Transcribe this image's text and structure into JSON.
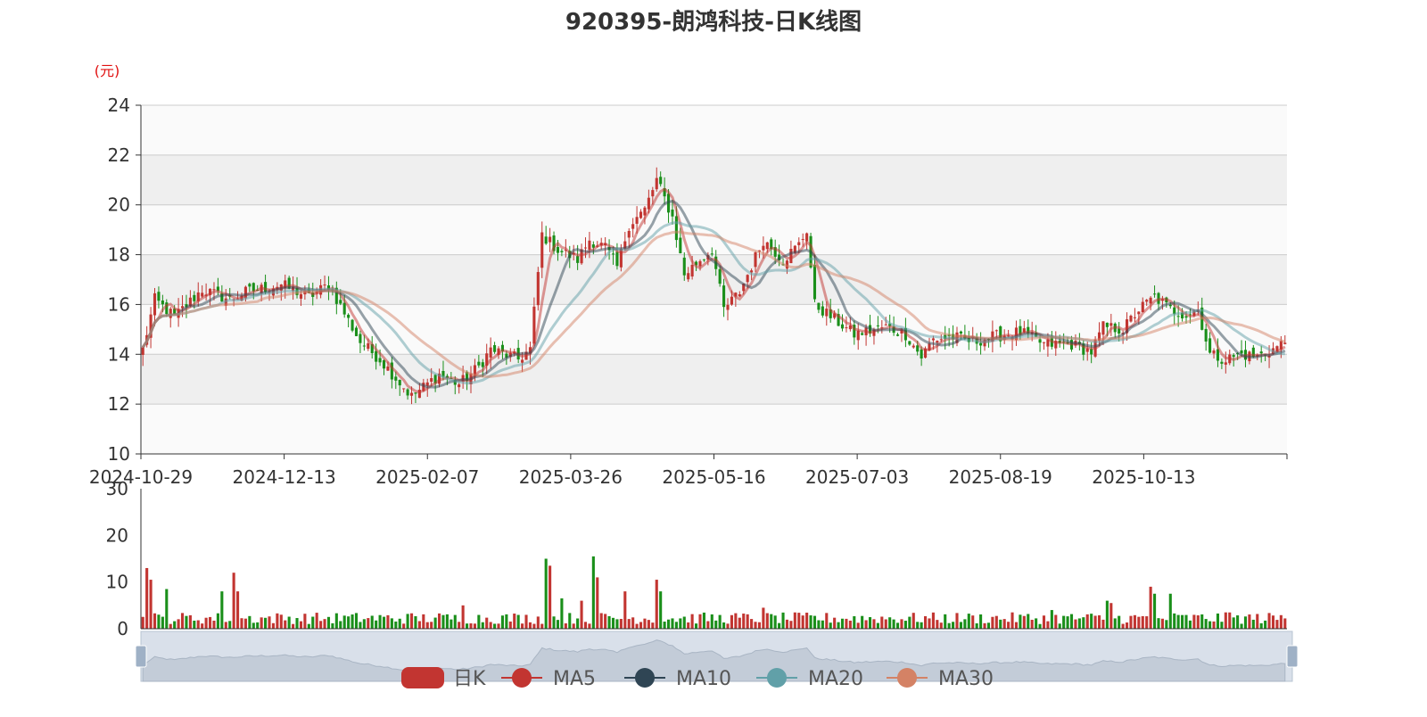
{
  "colors": {
    "up": "#c23531",
    "down": "#1a8f1a",
    "ma5": "#c23531",
    "ma10": "#2f4554",
    "ma20": "#61a0a8",
    "ma30": "#d48265",
    "grid_band": "#efefef",
    "axis": "#333333",
    "unit_label": "#e01010",
    "slider_bg": "#d9e0ea",
    "slider_handle": "#9fb1c6"
  },
  "chart_data": {
    "type": "candlestick",
    "title": "920395-朗鸿科技-日K线图",
    "y_unit_label": "(元)",
    "ylim": [
      10,
      24
    ],
    "y_ticks": [
      10,
      12,
      14,
      16,
      18,
      20,
      22,
      24
    ],
    "x_tick_labels": [
      "2024-10-29",
      "2024-12-13",
      "2025-02-07",
      "2025-03-26",
      "2025-05-16",
      "2025-07-03",
      "2025-08-19",
      "2025-10-13"
    ],
    "volume_ylim": [
      0,
      30
    ],
    "volume_ticks": [
      0,
      10,
      20,
      30
    ],
    "legend": [
      "日K",
      "MA5",
      "MA10",
      "MA20",
      "MA30"
    ],
    "price_keypoints": [
      {
        "i": 0,
        "p": 14.2
      },
      {
        "i": 3,
        "p": 16.2
      },
      {
        "i": 8,
        "p": 15.5
      },
      {
        "i": 15,
        "p": 16.6
      },
      {
        "i": 22,
        "p": 16.2
      },
      {
        "i": 26,
        "p": 16.5
      },
      {
        "i": 35,
        "p": 16.8
      },
      {
        "i": 42,
        "p": 16.3
      },
      {
        "i": 47,
        "p": 16.8
      },
      {
        "i": 55,
        "p": 14.5
      },
      {
        "i": 60,
        "p": 13.8
      },
      {
        "i": 68,
        "p": 12.3
      },
      {
        "i": 75,
        "p": 13.2
      },
      {
        "i": 80,
        "p": 12.8
      },
      {
        "i": 85,
        "p": 13.5
      },
      {
        "i": 88,
        "p": 14.2
      },
      {
        "i": 95,
        "p": 13.8
      },
      {
        "i": 98,
        "p": 14.2
      },
      {
        "i": 101,
        "p": 18.8
      },
      {
        "i": 105,
        "p": 18.2
      },
      {
        "i": 110,
        "p": 17.8
      },
      {
        "i": 113,
        "p": 18.6
      },
      {
        "i": 117,
        "p": 18.3
      },
      {
        "i": 120,
        "p": 17.5
      },
      {
        "i": 123,
        "p": 19.2
      },
      {
        "i": 127,
        "p": 19.8
      },
      {
        "i": 130,
        "p": 21.0
      },
      {
        "i": 134,
        "p": 19.5
      },
      {
        "i": 137,
        "p": 17.2
      },
      {
        "i": 141,
        "p": 17.8
      },
      {
        "i": 144,
        "p": 18.2
      },
      {
        "i": 147,
        "p": 15.8
      },
      {
        "i": 151,
        "p": 16.5
      },
      {
        "i": 157,
        "p": 18.6
      },
      {
        "i": 162,
        "p": 17.8
      },
      {
        "i": 166,
        "p": 18.4
      },
      {
        "i": 168,
        "p": 19.0
      },
      {
        "i": 170,
        "p": 16.0
      },
      {
        "i": 175,
        "p": 15.4
      },
      {
        "i": 180,
        "p": 14.8
      },
      {
        "i": 188,
        "p": 15.1
      },
      {
        "i": 193,
        "p": 14.8
      },
      {
        "i": 197,
        "p": 13.9
      },
      {
        "i": 200,
        "p": 14.6
      },
      {
        "i": 205,
        "p": 14.7
      },
      {
        "i": 210,
        "p": 14.5
      },
      {
        "i": 215,
        "p": 14.7
      },
      {
        "i": 222,
        "p": 14.9
      },
      {
        "i": 228,
        "p": 14.4
      },
      {
        "i": 235,
        "p": 14.4
      },
      {
        "i": 240,
        "p": 14.1
      },
      {
        "i": 243,
        "p": 15.1
      },
      {
        "i": 248,
        "p": 15.0
      },
      {
        "i": 252,
        "p": 15.8
      },
      {
        "i": 256,
        "p": 16.3
      },
      {
        "i": 260,
        "p": 15.8
      },
      {
        "i": 264,
        "p": 15.6
      },
      {
        "i": 267,
        "p": 15.8
      },
      {
        "i": 270,
        "p": 14.0
      },
      {
        "i": 274,
        "p": 13.8
      },
      {
        "i": 278,
        "p": 14.0
      },
      {
        "i": 282,
        "p": 13.9
      },
      {
        "i": 286,
        "p": 14.2
      },
      {
        "i": 289,
        "p": 14.5
      }
    ],
    "volume_spikes": [
      {
        "i": 1,
        "v": 13
      },
      {
        "i": 2,
        "v": 10.5
      },
      {
        "i": 6,
        "v": 8.5
      },
      {
        "i": 20,
        "v": 8
      },
      {
        "i": 23,
        "v": 12
      },
      {
        "i": 24,
        "v": 8
      },
      {
        "i": 81,
        "v": 5
      },
      {
        "i": 102,
        "v": 15
      },
      {
        "i": 103,
        "v": 13.5
      },
      {
        "i": 106,
        "v": 6.5
      },
      {
        "i": 111,
        "v": 6
      },
      {
        "i": 114,
        "v": 15.5
      },
      {
        "i": 115,
        "v": 11
      },
      {
        "i": 122,
        "v": 8
      },
      {
        "i": 130,
        "v": 10.5
      },
      {
        "i": 131,
        "v": 8
      },
      {
        "i": 157,
        "v": 4.5
      },
      {
        "i": 230,
        "v": 4
      },
      {
        "i": 244,
        "v": 6
      },
      {
        "i": 245,
        "v": 5.5
      },
      {
        "i": 255,
        "v": 9
      },
      {
        "i": 256,
        "v": 7.5
      },
      {
        "i": 260,
        "v": 7.5
      },
      {
        "i": 274,
        "v": 3.5
      }
    ]
  }
}
